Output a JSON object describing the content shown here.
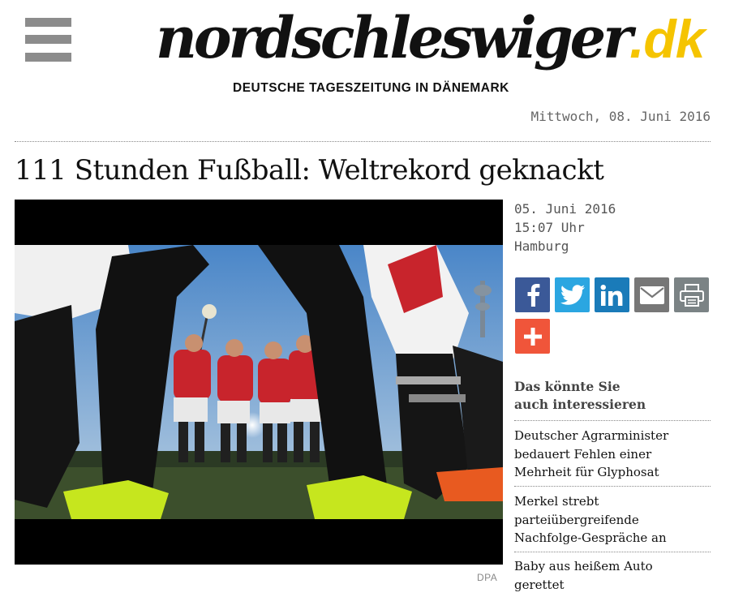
{
  "header": {
    "logo_main": "nordschleswiger",
    "logo_tld": ".dk",
    "tagline": "DEUTSCHE TAGESZEITUNG IN DÄNEMARK",
    "date": "Mittwoch, 08. Juni 2016",
    "menu_icon": "hamburger-icon"
  },
  "article": {
    "title": "111 Stunden Fußball: Weltrekord geknackt",
    "date": "05. Juni 2016",
    "time": "15:07 Uhr",
    "location": "Hamburg",
    "image_credit": "DPA"
  },
  "share": [
    {
      "name": "facebook",
      "icon": "facebook-icon",
      "color": "#3b5998"
    },
    {
      "name": "twitter",
      "icon": "twitter-icon",
      "color": "#2ba6e1"
    },
    {
      "name": "linkedin",
      "icon": "linkedin-icon",
      "color": "#1a7bb9"
    },
    {
      "name": "email",
      "icon": "mail-icon",
      "color": "#777777"
    },
    {
      "name": "print",
      "icon": "print-icon",
      "color": "#7b8385"
    },
    {
      "name": "more",
      "icon": "plus-icon",
      "color": "#f0553a"
    }
  ],
  "sidebar": {
    "heading_line1": "Das könnte Sie",
    "heading_line2": "auch interessieren",
    "items": [
      {
        "lines": [
          "Deutscher Agrarminister",
          "bedauert Fehlen einer",
          "Mehrheit für Glyphosat"
        ]
      },
      {
        "lines": [
          "Merkel strebt",
          "parteiübergreifende",
          "Nachfolge-Gespräche an"
        ]
      },
      {
        "lines": [
          "Baby aus heißem Auto",
          "gerettet"
        ]
      }
    ]
  },
  "colors": {
    "logo_accent": "#f5c400",
    "text": "#111111",
    "muted": "#666666"
  }
}
